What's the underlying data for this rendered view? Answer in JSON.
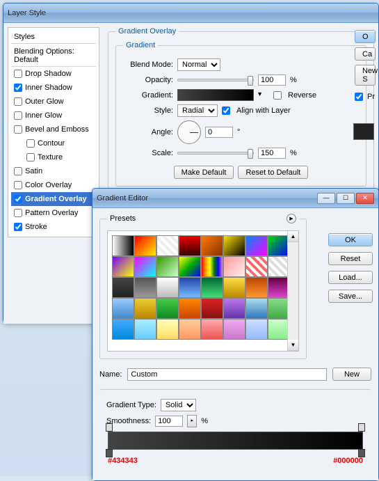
{
  "layerStyle": {
    "title": "Layer Style",
    "stylesHeader": "Styles",
    "blendingDefault": "Blending Options: Default",
    "items": [
      {
        "label": "Drop Shadow",
        "checked": false
      },
      {
        "label": "Inner Shadow",
        "checked": true
      },
      {
        "label": "Outer Glow",
        "checked": false
      },
      {
        "label": "Inner Glow",
        "checked": false
      },
      {
        "label": "Bevel and Emboss",
        "checked": false
      },
      {
        "label": "Contour",
        "checked": false,
        "indent": true
      },
      {
        "label": "Texture",
        "checked": false,
        "indent": true
      },
      {
        "label": "Satin",
        "checked": false
      },
      {
        "label": "Color Overlay",
        "checked": false
      },
      {
        "label": "Gradient Overlay",
        "checked": true,
        "selected": true
      },
      {
        "label": "Pattern Overlay",
        "checked": false
      },
      {
        "label": "Stroke",
        "checked": true
      }
    ],
    "sideButtons": {
      "ok": "O",
      "cancel": "Ca",
      "newStyle": "New S",
      "preview": "Pr"
    },
    "gradientOverlay": {
      "legend": "Gradient Overlay",
      "gradientLegend": "Gradient",
      "blendModeLabel": "Blend Mode:",
      "blendMode": "Normal",
      "opacityLabel": "Opacity:",
      "opacity": "100",
      "pct": "%",
      "gradientLabel": "Gradient:",
      "reverse": "Reverse",
      "styleLabel": "Style:",
      "style": "Radial",
      "alignWithLayer": "Align with Layer",
      "angleLabel": "Angle:",
      "angle": "0",
      "deg": "°",
      "scaleLabel": "Scale:",
      "scale": "150",
      "makeDefault": "Make Default",
      "resetDefault": "Reset to Default"
    }
  },
  "gradientEditor": {
    "title": "Gradient Editor",
    "presetsLabel": "Presets",
    "ok": "OK",
    "reset": "Reset",
    "load": "Load...",
    "save": "Save...",
    "nameLabel": "Name:",
    "name": "Custom",
    "new": "New",
    "gradientTypeLabel": "Gradient Type:",
    "gradientType": "Solid",
    "smoothnessLabel": "Smoothness:",
    "smoothness": "100",
    "pct": "%",
    "leftHex": "#434343",
    "rightHex": "#000000",
    "presetColors": [
      "linear-gradient(90deg,#fff,#000)",
      "linear-gradient(135deg,#f00,#fe0)",
      "repeating-linear-gradient(45deg,#eee 0 4px,#fff 4px 8px)",
      "linear-gradient(#e00,#300)",
      "linear-gradient(135deg,#f70,#830)",
      "linear-gradient(135deg,#fd0,#000)",
      "linear-gradient(135deg,#08f,#f0f)",
      "linear-gradient(135deg,#0d0,#00f)",
      "linear-gradient(135deg,#70f,#ff0)",
      "linear-gradient(135deg,#f0f,#0ff)",
      "linear-gradient(135deg,#390,#cfc)",
      "linear-gradient(135deg,#ff0,#0a0,#00f)",
      "linear-gradient(90deg,red,orange,yellow,green,blue,violet)",
      "linear-gradient(135deg,#f99,#fee)",
      "repeating-linear-gradient(45deg,#f66 0 4px,#fff 4px 8px)",
      "repeating-linear-gradient(45deg,#ddd 0 4px,#fff 4px 8px)",
      "linear-gradient(#444,#222)",
      "linear-gradient(#555,#999)",
      "linear-gradient(#fff,#bbb)",
      "linear-gradient(#24a,#7bf)",
      "linear-gradient(#063,#4d7)",
      "linear-gradient(#fd4,#b80)",
      "linear-gradient(#b40,#f93)",
      "linear-gradient(#604,#d4c)",
      "linear-gradient(#9cf,#48c)",
      "linear-gradient(#ec3,#b80)",
      "linear-gradient(#4c4,#182)",
      "linear-gradient(#f80,#c40)",
      "linear-gradient(#d22,#811)",
      "linear-gradient(#b7e,#63a)",
      "linear-gradient(#ade,#37b)",
      "linear-gradient(#8d8,#4a4)",
      "linear-gradient(#4af,#08d)",
      "linear-gradient(#aef,#6cf)",
      "linear-gradient(#ffb,#fd6)",
      "linear-gradient(#fc9,#f96)",
      "linear-gradient(#faa,#e55)",
      "linear-gradient(#eae,#c7c)",
      "linear-gradient(#cdf,#9bf)",
      "linear-gradient(#cfc,#8e8)"
    ]
  }
}
